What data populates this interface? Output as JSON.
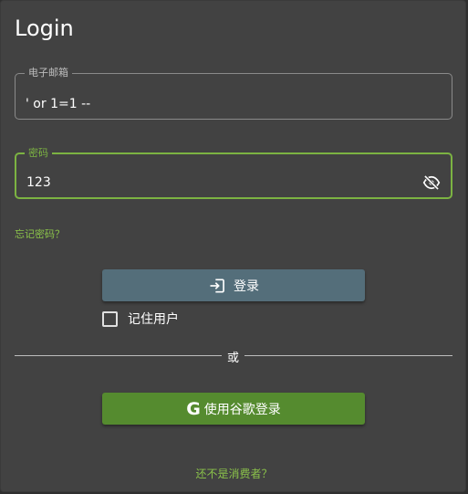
{
  "form": {
    "title": "Login",
    "email": {
      "label": "电子邮箱",
      "value": "' or 1=1 --"
    },
    "password": {
      "label": "密码",
      "value": "123",
      "toggle_icon": "eye-off-icon"
    },
    "forgot_password": "忘记密码？",
    "login_button": {
      "label": "登录",
      "icon": "login-icon"
    },
    "remember_me": {
      "label": "记住用户",
      "checked": false
    },
    "divider_text": "或",
    "google_button": {
      "label": "使用谷歌登录",
      "icon": "google-icon"
    },
    "signup_link": "还不是消费者？"
  },
  "colors": {
    "background": "#424242",
    "accent": "#7cb342",
    "login_button": "#546e7a",
    "google_button": "#558b2f",
    "link": "#8bc34a"
  }
}
